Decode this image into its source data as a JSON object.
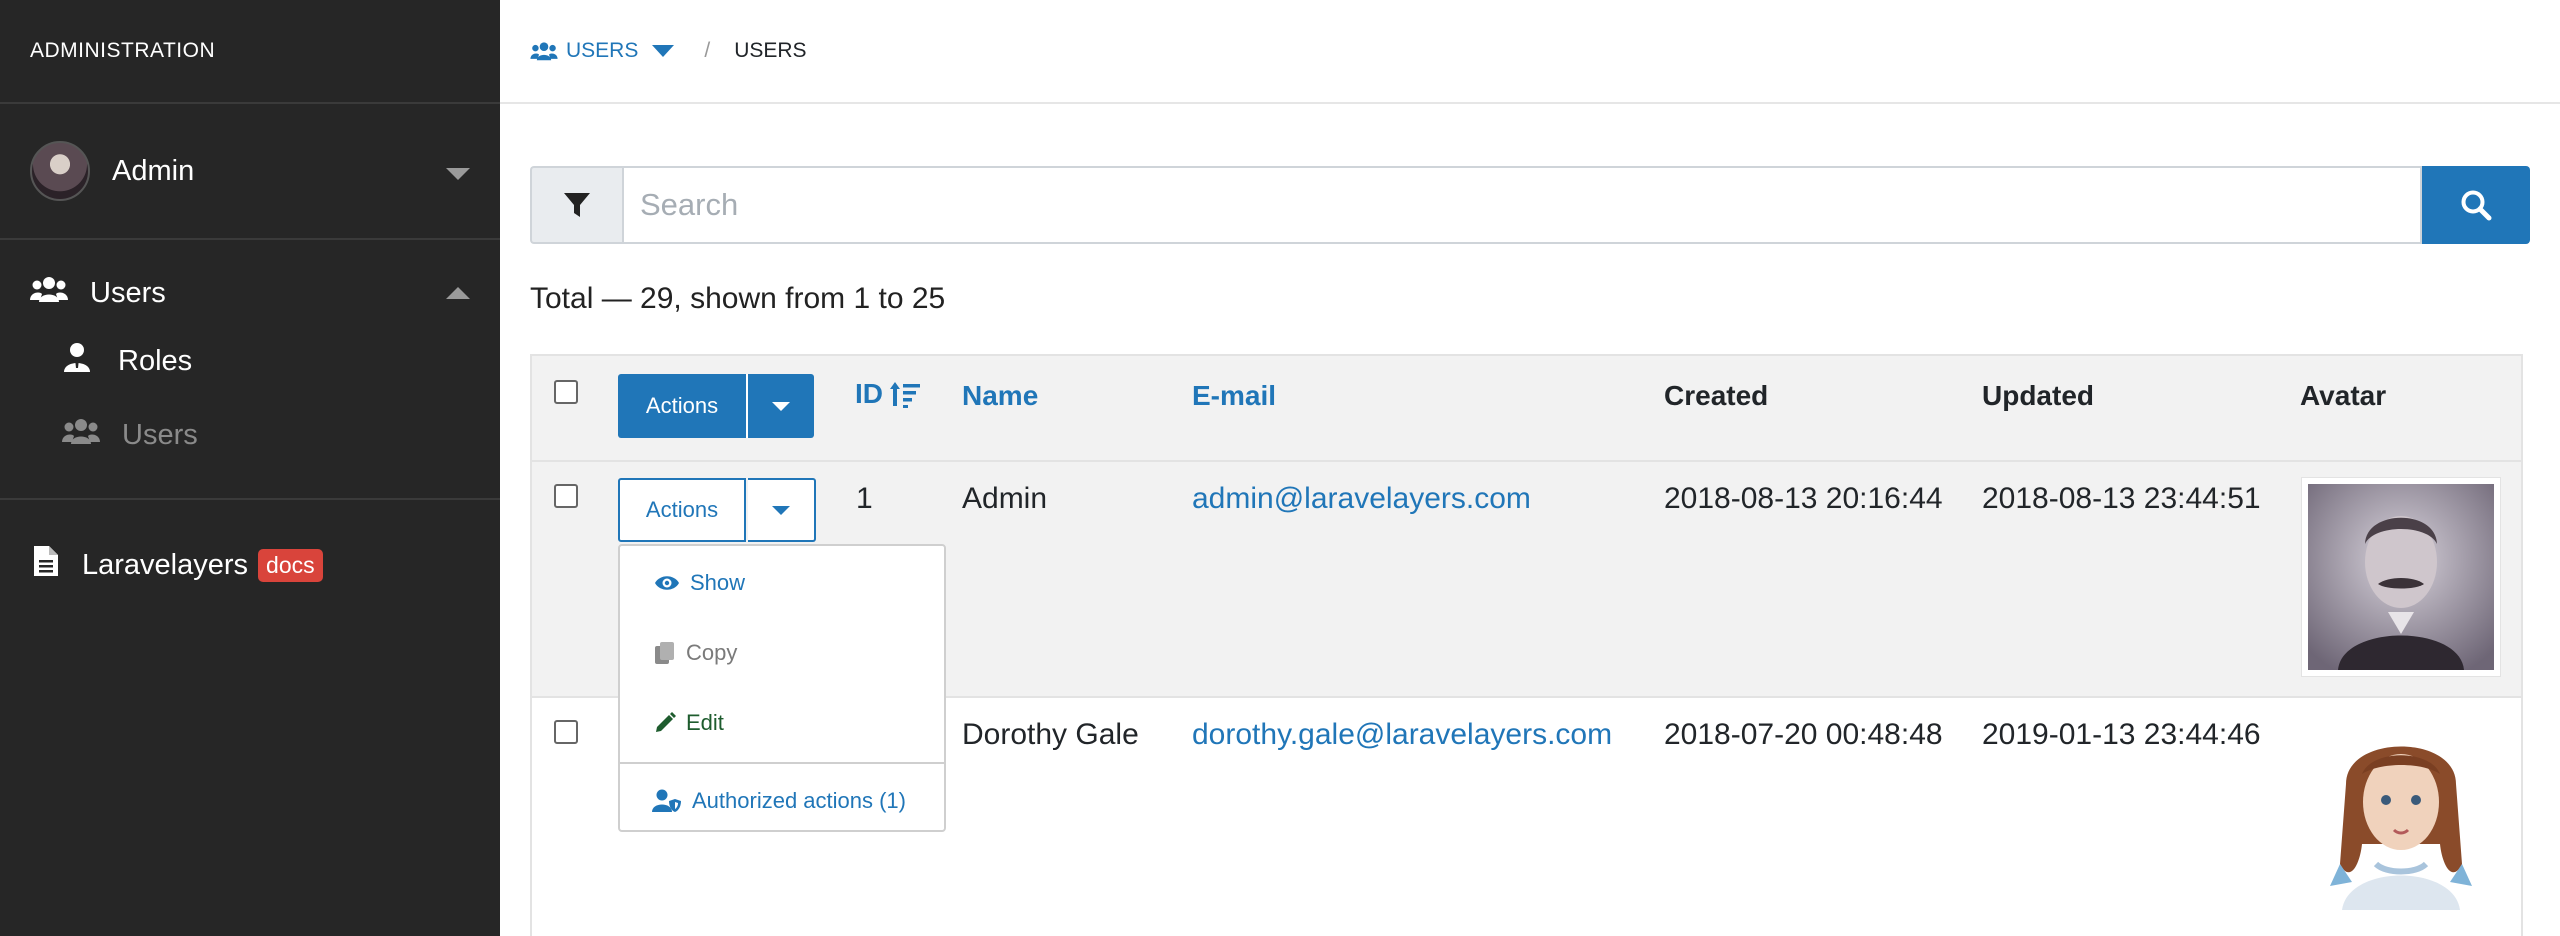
{
  "sidebar": {
    "title": "ADMINISTRATION",
    "user_name": "Admin",
    "nav": [
      {
        "label": "Users",
        "icon": "users-icon"
      },
      {
        "label": "Roles",
        "icon": "user-tie-icon"
      },
      {
        "label": "Users",
        "icon": "users-icon"
      }
    ],
    "docs": {
      "label": "Laravelayers",
      "badge": "docs"
    }
  },
  "breadcrumb": {
    "link": "USERS",
    "current": "USERS"
  },
  "search": {
    "placeholder": "Search"
  },
  "summary": "Total — 29, shown from 1 to 25",
  "table": {
    "actions_label": "Actions",
    "headers": {
      "id": "ID",
      "name": "Name",
      "email": "E-mail",
      "created": "Created",
      "updated": "Updated",
      "avatar": "Avatar"
    },
    "rows": [
      {
        "id": "1",
        "name": "Admin",
        "email": "admin@laravelayers.com",
        "created": "2018-08-13 20:16:44",
        "updated": "2018-08-13 23:44:51"
      },
      {
        "id": "",
        "name": "Dorothy Gale",
        "email": "dorothy.gale@laravelayers.com",
        "created": "2018-07-20 00:48:48",
        "updated": "2019-01-13 23:44:46"
      }
    ]
  },
  "dropdown": {
    "items": [
      "Show",
      "Copy",
      "Edit"
    ],
    "authorized": "Authorized actions (1)"
  },
  "colors": {
    "accent": "#2076b8",
    "sidebar": "#262626",
    "badge": "#d9443b",
    "edit": "#1e5c2e"
  }
}
